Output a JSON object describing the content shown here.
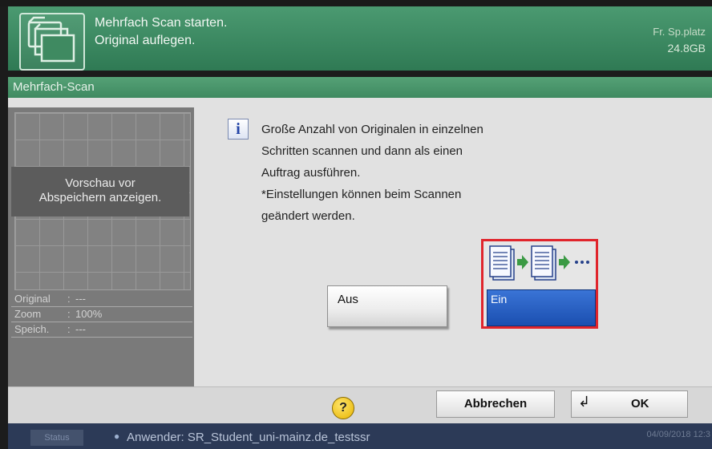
{
  "header": {
    "message_line1": "Mehrfach Scan starten.",
    "message_line2": "Original auflegen.",
    "free_space_label": "Fr. Sp.platz",
    "free_space_value": "24.8GB",
    "icon": "multi-document-icon"
  },
  "title": "Mehrfach-Scan",
  "preview": {
    "button_label_line1": "Vorschau vor",
    "button_label_line2": "Abspeichern anzeigen.",
    "info": [
      {
        "key": "Original",
        "value": "---"
      },
      {
        "key": "Zoom",
        "value": "100%"
      },
      {
        "key": "Speich.",
        "value": "---"
      }
    ]
  },
  "info": {
    "icon": "info-icon",
    "lines": [
      "Große Anzahl von Originalen in einzelnen",
      "Schritten scannen und dann als einen",
      "Auftrag ausführen.",
      "*Einstellungen können beim Scannen",
      "geändert werden."
    ]
  },
  "options": {
    "off_label": "Aus",
    "on_label": "Ein",
    "on_icon": "multi-scan-pages-icon",
    "highlight_color": "#e0252c",
    "selected_color": "#1b4fb0"
  },
  "bottom": {
    "help_label": "?",
    "cancel_label": "Abbrechen",
    "ok_label": "OK"
  },
  "status": {
    "status_label": "Status",
    "user_text": "Anwender: SR_Student_uni-mainz.de_testssr",
    "datetime": "04/09/2018 12:3"
  }
}
